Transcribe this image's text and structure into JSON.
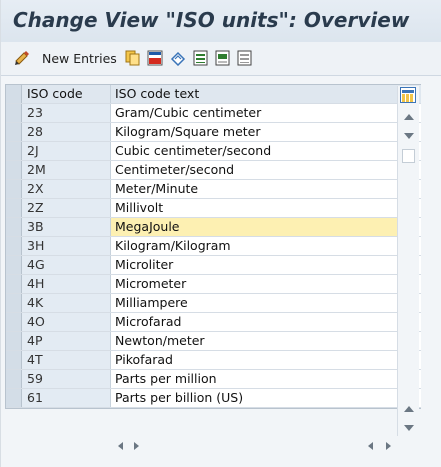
{
  "header": {
    "title": "Change View \"ISO units\": Overview"
  },
  "toolbar": {
    "new_entries_label": "New Entries",
    "icons": [
      "glasses-pen-icon",
      "copy-icon",
      "delete-icon",
      "undo-icon",
      "select-all-icon",
      "select-block-icon",
      "deselect-all-icon"
    ]
  },
  "table": {
    "columns": [
      "ISO code",
      "ISO code text"
    ],
    "rows": [
      {
        "code": "23",
        "text": "Gram/Cubic centimeter"
      },
      {
        "code": "28",
        "text": "Kilogram/Square meter"
      },
      {
        "code": "2J",
        "text": "Cubic centimeter/second"
      },
      {
        "code": "2M",
        "text": "Centimeter/second"
      },
      {
        "code": "2X",
        "text": "Meter/Minute"
      },
      {
        "code": "2Z",
        "text": "Millivolt"
      },
      {
        "code": "3B",
        "text": "MegaJoule"
      },
      {
        "code": "3H",
        "text": "Kilogram/Kilogram"
      },
      {
        "code": "4G",
        "text": "Microliter"
      },
      {
        "code": "4H",
        "text": "Micrometer"
      },
      {
        "code": "4K",
        "text": "Milliampere"
      },
      {
        "code": "4O",
        "text": "Microfarad"
      },
      {
        "code": "4P",
        "text": "Newton/meter"
      },
      {
        "code": "4T",
        "text": "Pikofarad"
      },
      {
        "code": "59",
        "text": "Parts per million"
      },
      {
        "code": "61",
        "text": "Parts per billion (US)"
      }
    ],
    "selected_index": 6
  },
  "colors": {
    "title_bg": "#dce5ee",
    "key_column_bg": "#e3ebf3",
    "selected_row_bg": "#fdf0b2",
    "settings_border": "#3a74b8"
  }
}
